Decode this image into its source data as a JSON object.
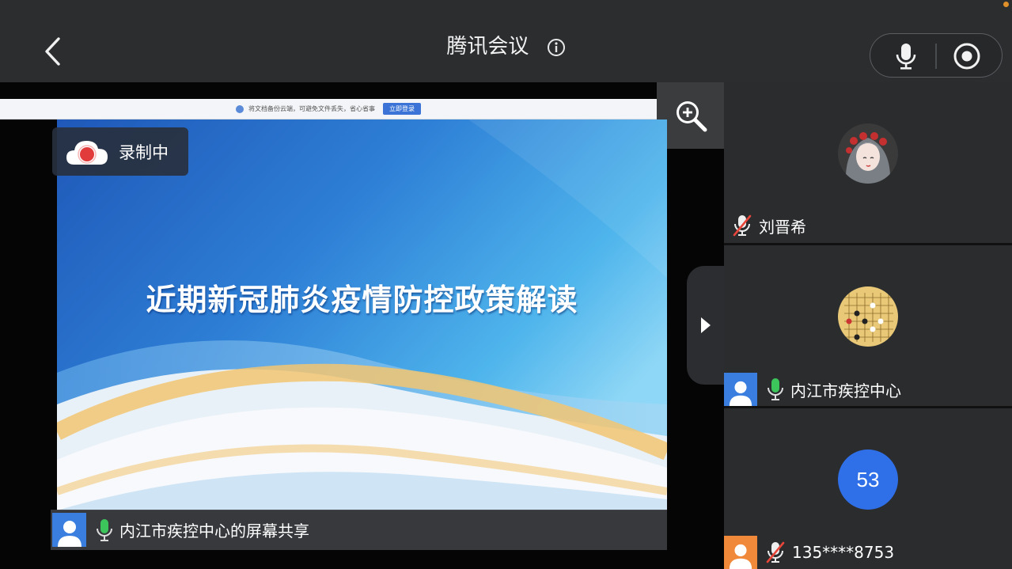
{
  "app": {
    "title": "腾讯会议"
  },
  "recording": {
    "label": "录制中"
  },
  "browser_notice": {
    "text": "将文档备份云端，可避免文件丢失，省心省事",
    "button": "立即登录"
  },
  "slide": {
    "title": "近期新冠肺炎疫情防控政策解读"
  },
  "share": {
    "caption": "内江市疾控中心的屏幕共享"
  },
  "participants": [
    {
      "name": "刘晋希",
      "mic": "muted"
    },
    {
      "name": "内江市疾控中心",
      "mic": "on"
    },
    {
      "name": "135****8753",
      "mic": "muted",
      "avatar_text": "53"
    }
  ],
  "colors": {
    "accent": "#3a7fe0",
    "mic_on": "#3cc55a",
    "muted": "#e8463a",
    "recording": "#e23b3b"
  }
}
